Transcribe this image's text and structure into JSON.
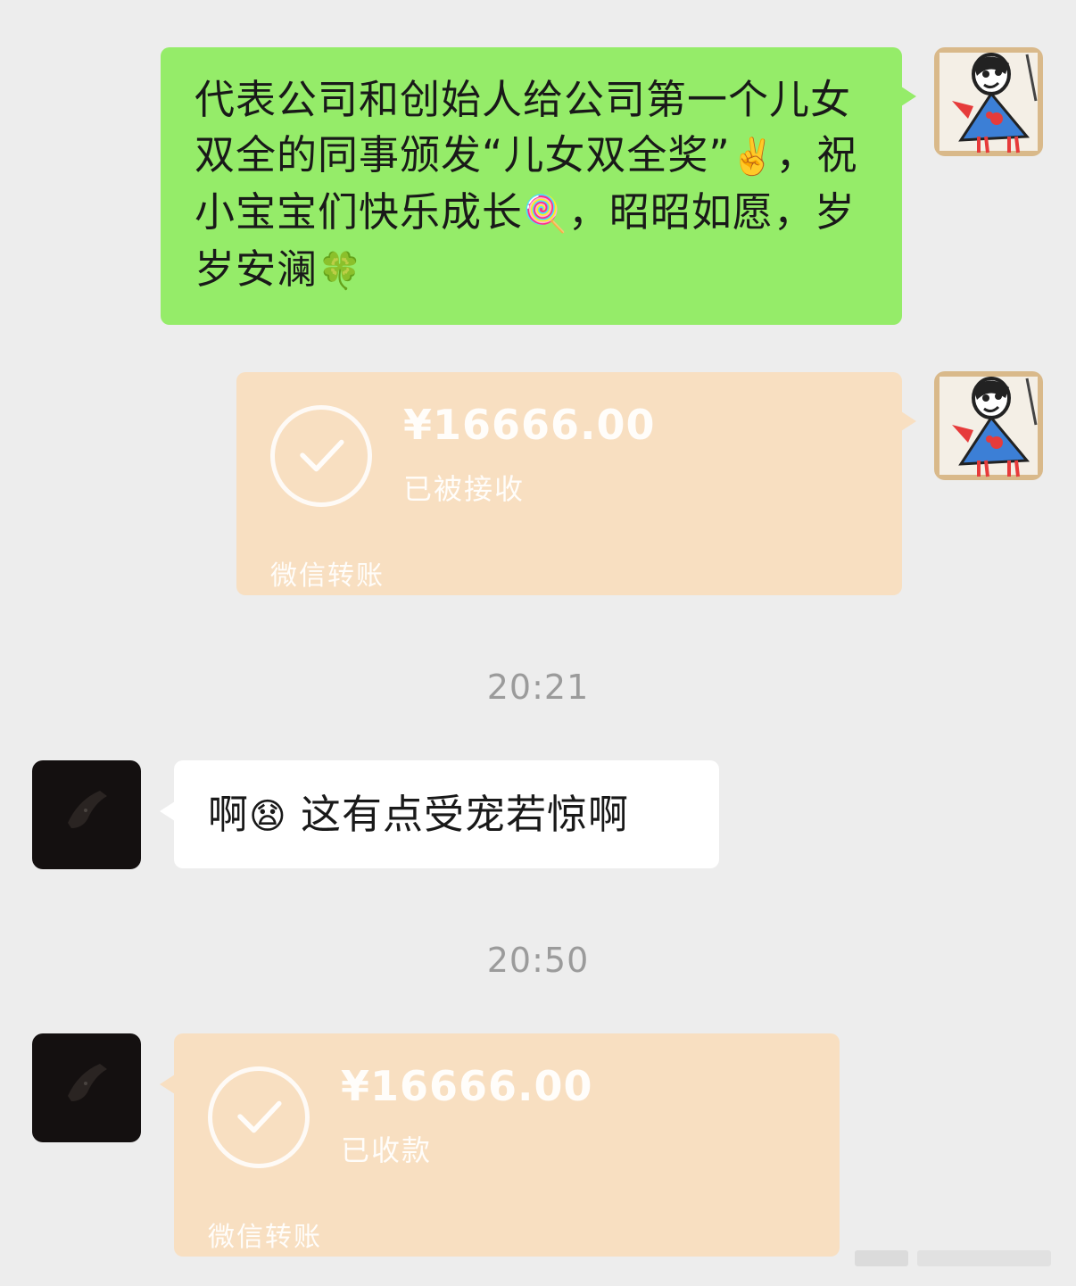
{
  "messages": [
    {
      "text_parts": [
        "代表公司和创始人给公司第一个儿女双全的同事颁发“儿女双全奖”",
        "✌️",
        "，祝小宝宝们快乐成长",
        "🍭",
        "，昭昭如愿，岁岁安澜",
        "🍀"
      ]
    },
    {
      "amount": "¥16666.00",
      "status": "已被接收",
      "label": "微信转账"
    },
    {
      "time": "20:21"
    },
    {
      "text_parts": [
        "啊",
        "😧",
        " 这有点受宠若惊啊"
      ]
    },
    {
      "time": "20:50"
    },
    {
      "amount": "¥16666.00",
      "status": "已收款",
      "label": "微信转账"
    }
  ],
  "colors": {
    "background": "#ededed",
    "self_bubble": "#95ec69",
    "other_bubble": "#ffffff",
    "transfer_bubble": "#f8dfc1",
    "timestamp": "#9b9b9b"
  },
  "icons": [
    "sender-avatar-drawing-icon",
    "receiver-avatar-dark-icon",
    "checkmark-icon"
  ]
}
